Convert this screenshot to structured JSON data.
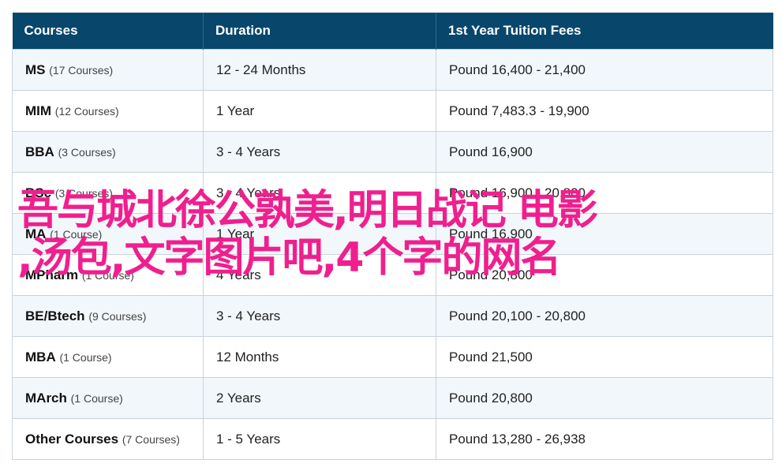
{
  "table": {
    "headers": [
      "Courses",
      "Duration",
      "1st Year Tuition Fees"
    ],
    "rows": [
      {
        "course": "MS",
        "count": "(17 Courses)",
        "duration": "12 - 24 Months",
        "fees": "Pound 16,400 - 21,400"
      },
      {
        "course": "MIM",
        "count": "(12 Courses)",
        "duration": "1 Year",
        "fees": "Pound 7,483.3 - 19,900"
      },
      {
        "course": "BBA",
        "count": "(3 Courses)",
        "duration": "3 - 4 Years",
        "fees": "Pound 16,900"
      },
      {
        "course": "BSc",
        "count": "(3 Courses)",
        "duration": "3 - 4 Years",
        "fees": "Pound 16,900 - 20,800"
      },
      {
        "course": "MA",
        "count": "(1 Course)",
        "duration": "1 Year",
        "fees": "Pound 16,900"
      },
      {
        "course": "MPharm",
        "count": "(1 Course)",
        "duration": "4 Years",
        "fees": "Pound 20,800"
      },
      {
        "course": "BE/Btech",
        "count": "(9 Courses)",
        "duration": "3 - 4 Years",
        "fees": "Pound 20,100 - 20,800"
      },
      {
        "course": "MBA",
        "count": "(1 Course)",
        "duration": "12 Months",
        "fees": "Pound 21,500"
      },
      {
        "course": "MArch",
        "count": "(1 Course)",
        "duration": "2 Years",
        "fees": "Pound 20,800"
      },
      {
        "course": "Other Courses",
        "count": "(7 Courses)",
        "duration": "1 - 5 Years",
        "fees": "Pound 13,280 - 26,938"
      }
    ]
  },
  "overlay": {
    "line1": "吾与城北徐公孰美,明日战记 电影",
    "line2": ",汤包,文字图片吧,4个字的网名",
    "color": "#f01f8e"
  },
  "colors": {
    "header_bg": "#08476b",
    "row_alt_bg": "#f2f7fb",
    "border": "#c9d3da"
  }
}
